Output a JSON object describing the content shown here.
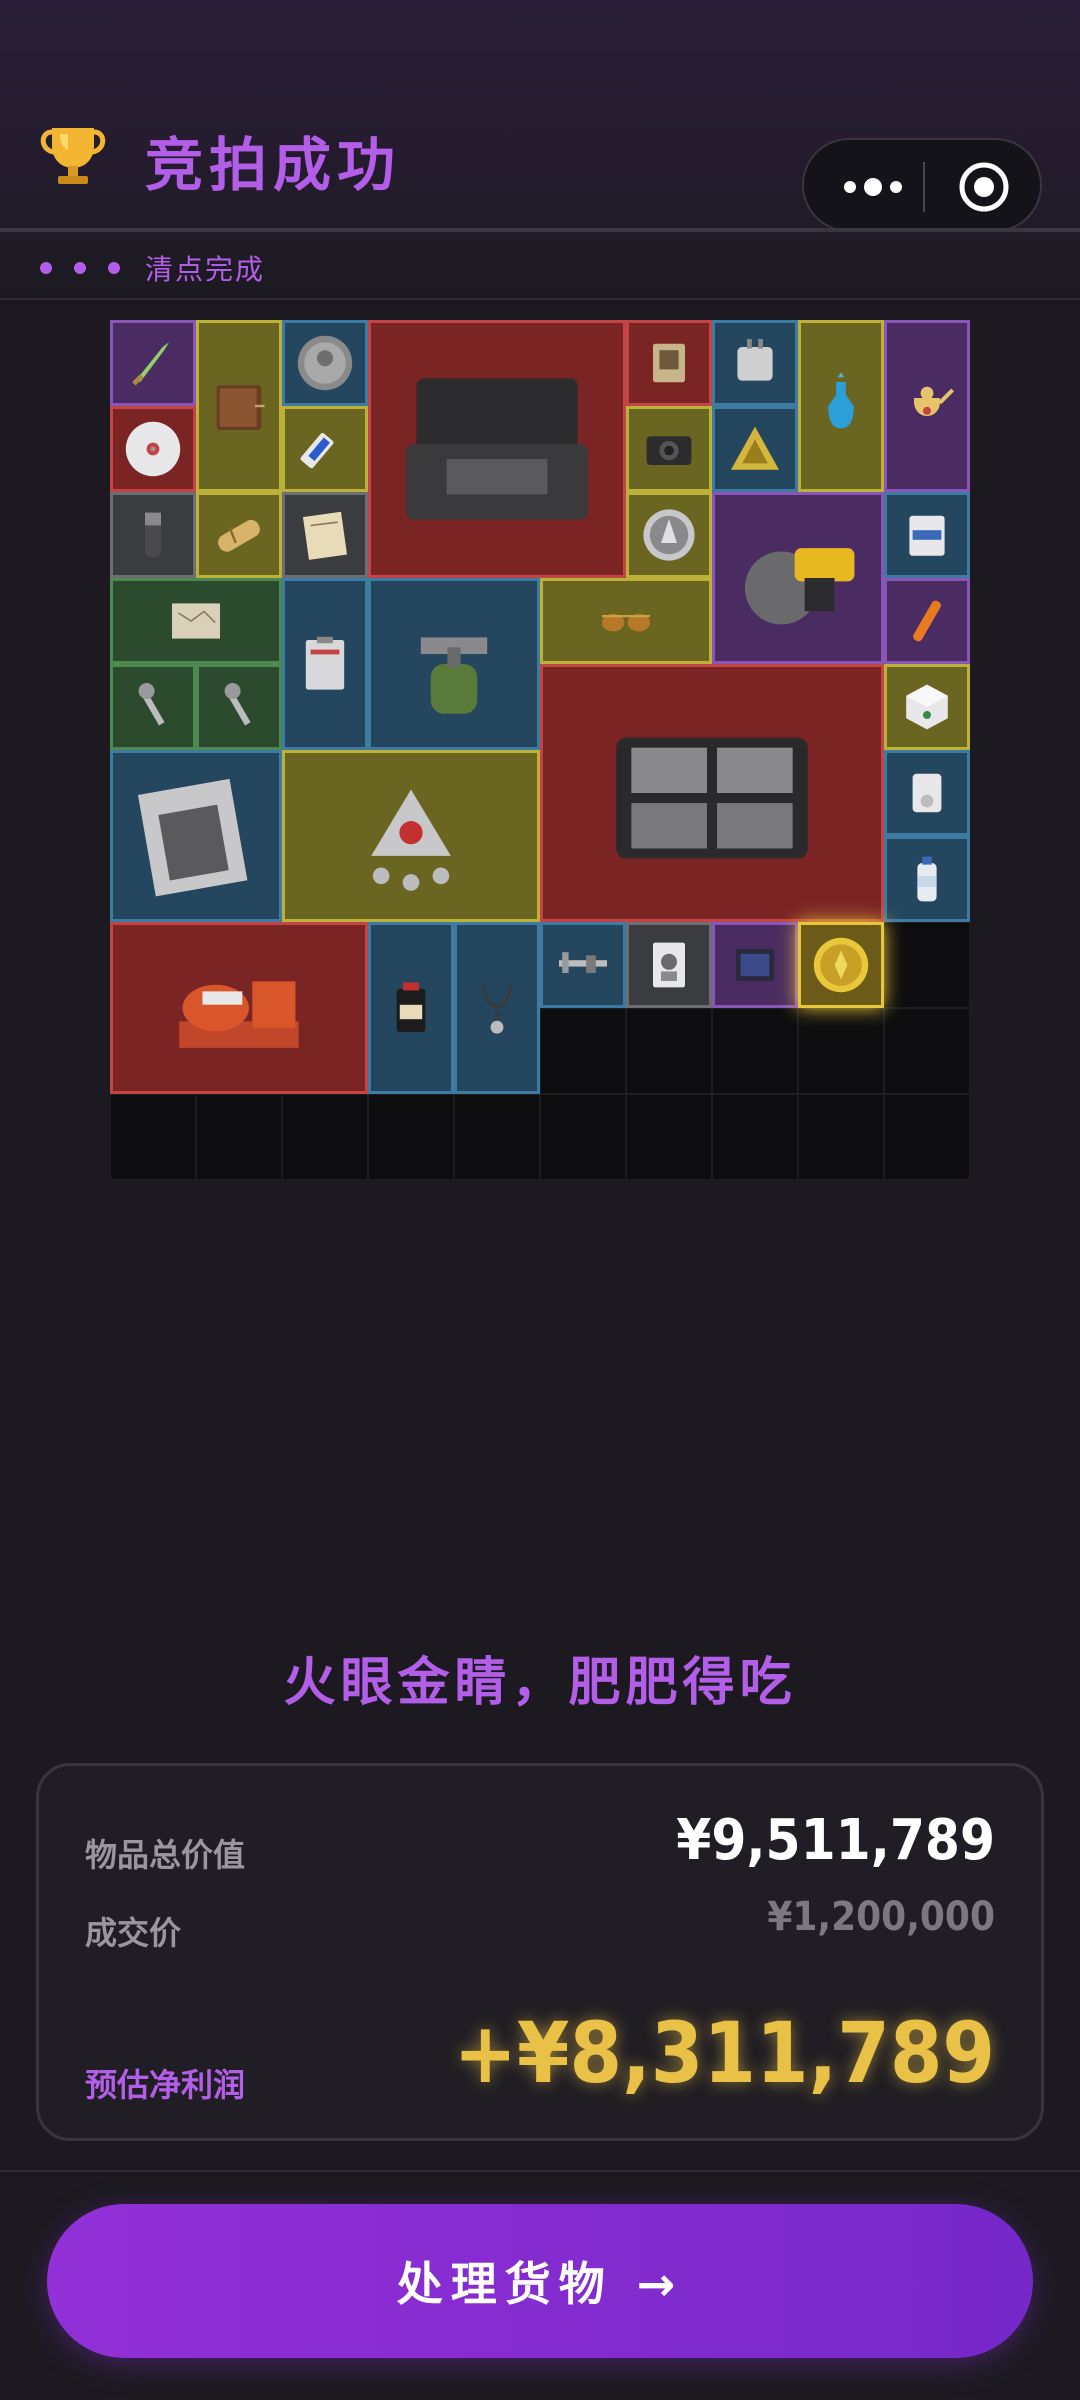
{
  "header": {
    "title": "竞拍成功",
    "icon": "trophy-icon"
  },
  "capsule": {
    "menu_icon": "more-dots-icon",
    "close_icon": "target-circle-icon"
  },
  "status": {
    "text": "清点完成"
  },
  "inventory": {
    "columns": 10,
    "rows": 10,
    "items": [
      {
        "id": "dagger",
        "rarity": "purple",
        "icon": "dagger-icon"
      },
      {
        "id": "leather-journal",
        "rarity": "yellow",
        "icon": "journal-icon"
      },
      {
        "id": "ancient-coin",
        "rarity": "blue",
        "icon": "coin-icon"
      },
      {
        "id": "equipment-case",
        "rarity": "red",
        "icon": "case-icon"
      },
      {
        "id": "circuit-chip",
        "rarity": "red",
        "icon": "chip-icon"
      },
      {
        "id": "power-adapter",
        "rarity": "blue",
        "icon": "adapter-icon"
      },
      {
        "id": "perfume-bottle",
        "rarity": "yellow",
        "icon": "bottle-icon"
      },
      {
        "id": "golden-teapot",
        "rarity": "purple",
        "icon": "teapot-icon"
      },
      {
        "id": "cd-disc",
        "rarity": "red",
        "icon": "disc-icon"
      },
      {
        "id": "usb-drive",
        "rarity": "yellow",
        "icon": "usb-icon"
      },
      {
        "id": "camera",
        "rarity": "yellow",
        "icon": "camera-icon"
      },
      {
        "id": "pyramid",
        "rarity": "blue",
        "icon": "pyramid-icon"
      },
      {
        "id": "pepper-grinder",
        "rarity": "gray",
        "icon": "grinder-icon"
      },
      {
        "id": "scroll-capsule",
        "rarity": "yellow",
        "icon": "capsule-icon"
      },
      {
        "id": "paper-note",
        "rarity": "gray",
        "icon": "note-icon"
      },
      {
        "id": "emblem-badge",
        "rarity": "yellow",
        "icon": "emblem-icon"
      },
      {
        "id": "circular-saw",
        "rarity": "purple",
        "icon": "saw-icon"
      },
      {
        "id": "pill-box",
        "rarity": "blue",
        "icon": "pillbox-icon"
      },
      {
        "id": "old-map",
        "rarity": "green",
        "icon": "map-icon"
      },
      {
        "id": "clipboard",
        "rarity": "blue",
        "icon": "clipboard-icon"
      },
      {
        "id": "camp-stove",
        "rarity": "blue",
        "icon": "stove-icon"
      },
      {
        "id": "sunglasses",
        "rarity": "yellow",
        "icon": "sunglasses-icon"
      },
      {
        "id": "flare",
        "rarity": "purple",
        "icon": "flare-icon"
      },
      {
        "id": "wrench-a",
        "rarity": "green",
        "icon": "wrench-icon"
      },
      {
        "id": "wrench-b",
        "rarity": "green",
        "icon": "wrench-icon"
      },
      {
        "id": "battery-pack",
        "rarity": "red",
        "icon": "battery-case-icon"
      },
      {
        "id": "puzzle-cube",
        "rarity": "yellow",
        "icon": "cube-icon"
      },
      {
        "id": "magazine",
        "rarity": "blue",
        "icon": "magazine-icon"
      },
      {
        "id": "pendant",
        "rarity": "yellow",
        "icon": "pendant-icon"
      },
      {
        "id": "mp3-player",
        "rarity": "blue",
        "icon": "mp3-icon"
      },
      {
        "id": "water-bottle",
        "rarity": "blue",
        "icon": "water-bottle-icon"
      },
      {
        "id": "generator",
        "rarity": "red",
        "icon": "generator-icon"
      },
      {
        "id": "black-powder",
        "rarity": "blue",
        "icon": "powder-can-icon"
      },
      {
        "id": "stethoscope",
        "rarity": "blue",
        "icon": "stethoscope-icon"
      },
      {
        "id": "caliper",
        "rarity": "blue",
        "icon": "caliper-icon"
      },
      {
        "id": "playing-card",
        "rarity": "gray",
        "icon": "card-icon"
      },
      {
        "id": "cpu-chip",
        "rarity": "purple",
        "icon": "cpu-icon"
      },
      {
        "id": "gold-medallion",
        "rarity": "gold",
        "icon": "medallion-icon"
      }
    ]
  },
  "slogan": "火眼金睛，肥肥得吃",
  "summary": {
    "total_value_label": "物品总价值",
    "total_value": "¥9,511,789",
    "deal_price_label": "成交价",
    "deal_price": "¥1,200,000",
    "profit_label": "预估净利润",
    "profit": "+¥8,311,789",
    "profit_color": "#e9c147"
  },
  "action": {
    "label": "处理货物 →"
  }
}
